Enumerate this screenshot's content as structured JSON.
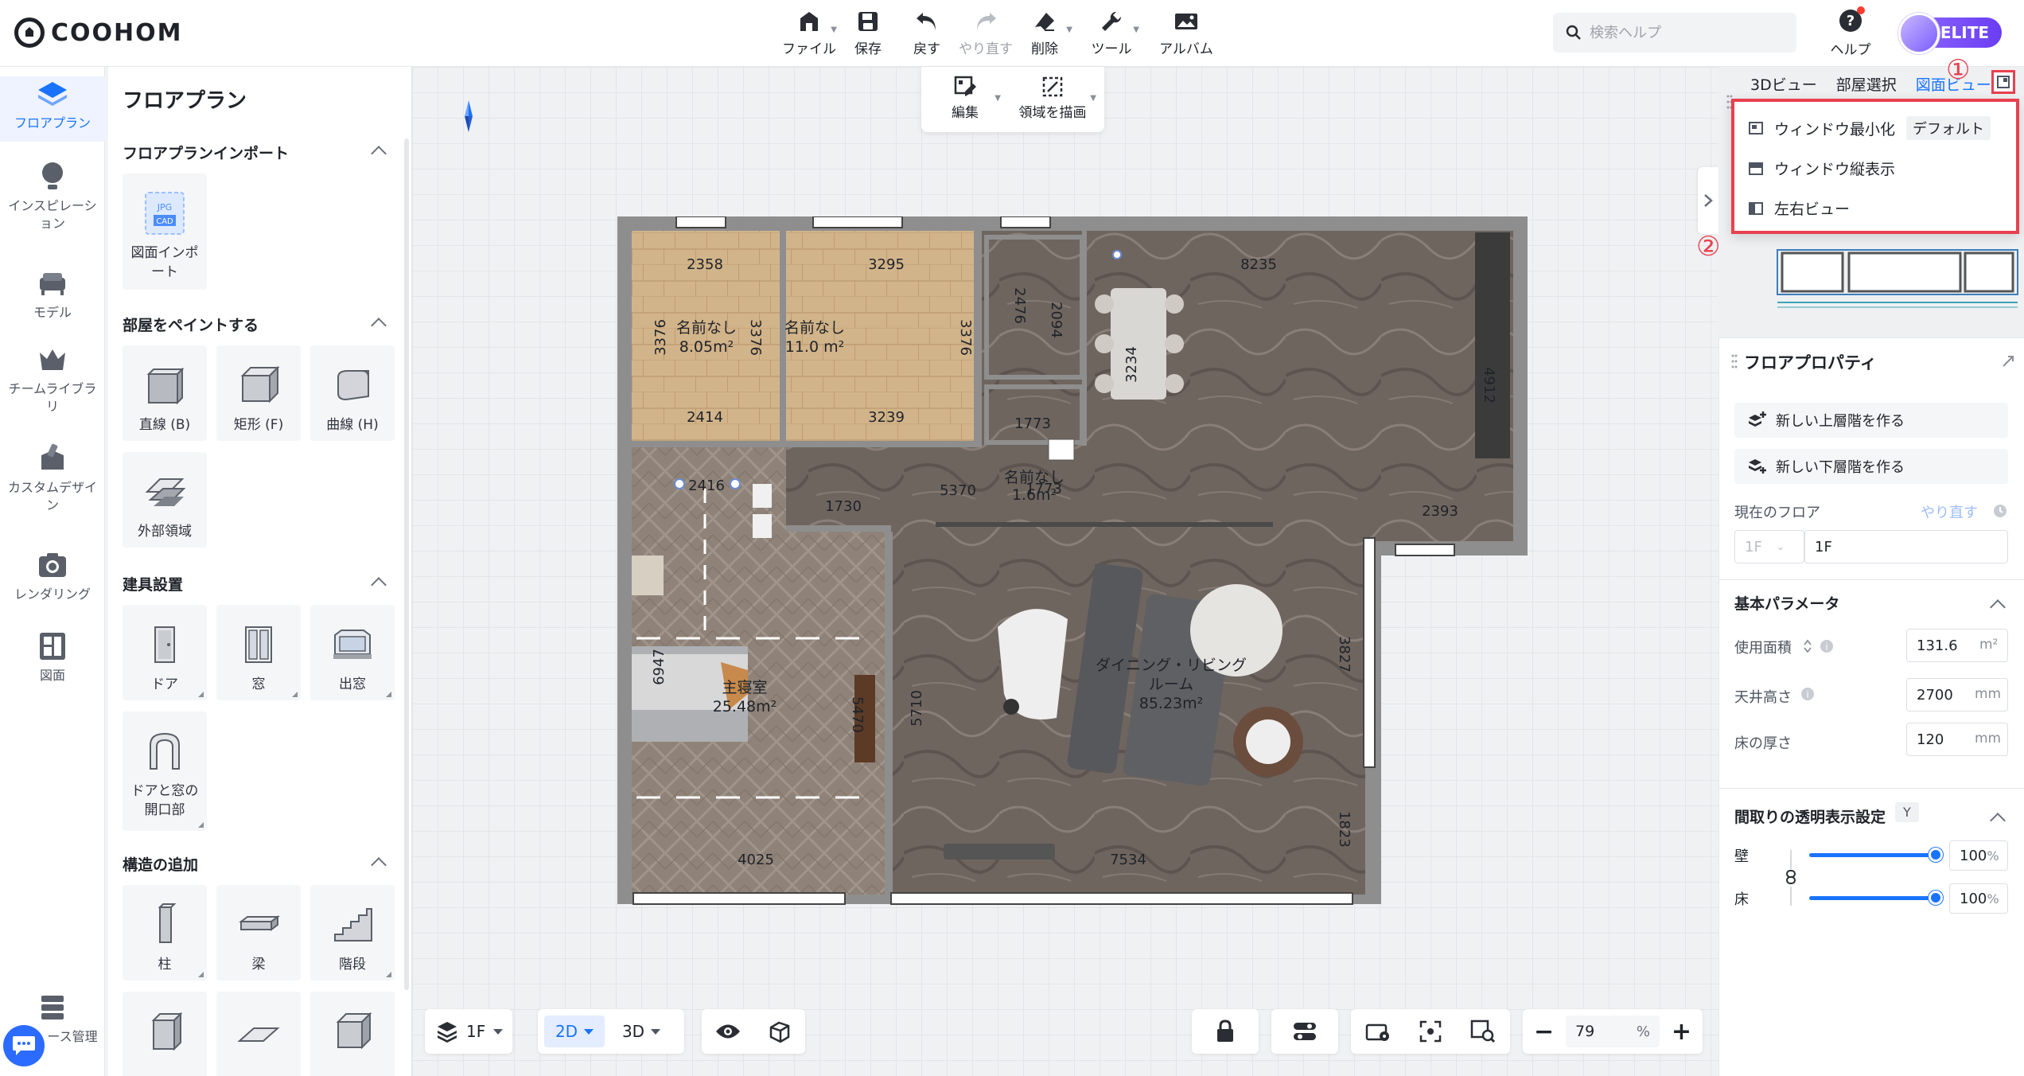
{
  "app": {
    "logo_text": "COOHOM",
    "brand_color": "#1a73ff",
    "annotation_color": "#e8414f"
  },
  "toolbar": {
    "file": "ファイル",
    "save": "保存",
    "undo": "戻す",
    "redo": "やり直す",
    "delete": "削除",
    "tools": "ツール",
    "album": "アルバム"
  },
  "search": {
    "placeholder": "検索ヘルプ"
  },
  "help": {
    "label": "ヘルプ"
  },
  "account": {
    "badge": "ELITE"
  },
  "rail": {
    "items": [
      {
        "label": "フロアプラン",
        "icon": "floorplan-icon"
      },
      {
        "label": "インスピレーション",
        "icon": "inspiration-icon"
      },
      {
        "label": "モデル",
        "icon": "model-icon"
      },
      {
        "label": "チームライブラリ",
        "icon": "team-library-icon"
      },
      {
        "label": "カスタムデザイン",
        "icon": "custom-design-icon"
      },
      {
        "label": "レンダリング",
        "icon": "rendering-icon"
      },
      {
        "label": "図面",
        "icon": "drawing-icon"
      },
      {
        "label": "ース管理",
        "icon": "resource-icon"
      }
    ]
  },
  "left_panel": {
    "title": "フロアプラン",
    "sections": {
      "import": {
        "title": "フロアプランインポート",
        "items": [
          "図面インポート"
        ]
      },
      "paint": {
        "title": "部屋をペイントする",
        "items": [
          "直線 (B)",
          "矩形 (F)",
          "曲線 (H)",
          "外部領域"
        ]
      },
      "fixtures": {
        "title": "建具設置",
        "items": [
          "ドア",
          "窓",
          "出窓",
          "ドアと窓の開口部"
        ]
      },
      "structure": {
        "title": "構造の追加",
        "items": [
          "柱",
          "梁",
          "階段"
        ]
      }
    }
  },
  "edit_tools": {
    "edit": "編集",
    "draw_area": "領域を描画"
  },
  "floor_plan": {
    "rooms": [
      {
        "name": "名前なし",
        "area": "8.05m²"
      },
      {
        "name": "名前なし",
        "area": "11.0 m²"
      },
      {
        "name": "名前なし",
        "area": "1.6m²"
      },
      {
        "name": "主寝室",
        "area": "25.48m²"
      },
      {
        "name": "ダイニング・リビング",
        "name2": "ルーム",
        "area": "85.23m²"
      }
    ],
    "dims": {
      "d2358": "2358",
      "d3295": "3295",
      "d8235": "8235",
      "d3376a": "3376",
      "d3376b": "3376",
      "d3376c": "3376",
      "d2414": "2414",
      "d3239": "3239",
      "d2476": "2476",
      "d2094": "2094",
      "d1773a": "1773",
      "d1773b": "1773",
      "d3234": "3234",
      "d4912": "4912",
      "d2416": "2416",
      "d1730": "1730",
      "d5370": "5370",
      "d2393": "2393",
      "d6947": "6947",
      "d5470": "5470",
      "d5710": "5710",
      "d3827": "3827",
      "d1823": "1823",
      "d4025": "4025",
      "d7534": "7534"
    }
  },
  "bottom": {
    "floor": "1F",
    "mode_2d": "2D",
    "mode_3d": "3D",
    "zoom_value": "79",
    "zoom_unit": "%"
  },
  "right_panel": {
    "tabs": {
      "view3d": "3Dビュー",
      "room_select": "部屋選択",
      "drawing": "図面ビュー"
    },
    "annotations": {
      "one": "①",
      "two": "②"
    },
    "view_menu": [
      {
        "label": "ウィンドウ最小化",
        "tag": "デフォルト"
      },
      {
        "label": "ウィンドウ縦表示"
      },
      {
        "label": "左右ビュー"
      }
    ],
    "properties": {
      "title": "フロアプロパティ",
      "new_upper": "新しい上層階を作る",
      "new_lower": "新しい下層階を作る",
      "current_floor_label": "現在のフロア",
      "redo_link": "やり直す",
      "floor_select": "1F",
      "floor_name": "1F",
      "basic_params_title": "基本パラメータ",
      "area_label": "使用面積",
      "area_value": "131.6",
      "area_unit": "m²",
      "ceiling_label": "天井高さ",
      "ceiling_value": "2700",
      "ceiling_unit": "mm",
      "floor_thickness_label": "床の厚さ",
      "floor_thickness_value": "120",
      "floor_thickness_unit": "mm",
      "transparency_title": "間取りの透明表示設定",
      "transparency_key": "Y",
      "wall_label": "壁",
      "wall_value": "100",
      "wall_percent": 100,
      "floor_label": "床",
      "floor_value": "100",
      "floor_percent": 100,
      "pct": "%"
    }
  }
}
